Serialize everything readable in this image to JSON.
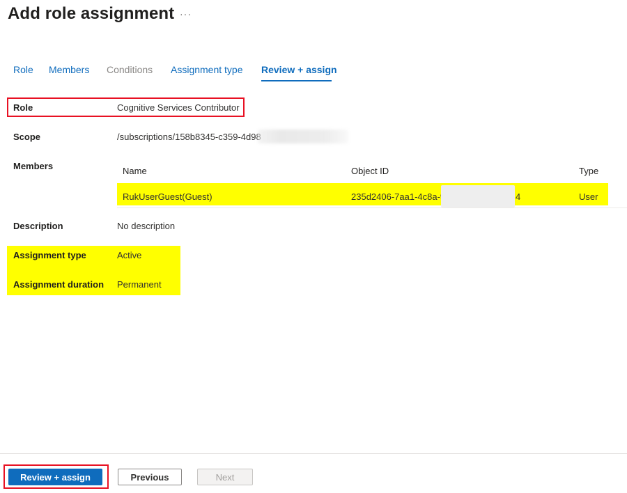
{
  "header": {
    "title": "Add role assignment",
    "more_icon": "more-horizontal-icon",
    "more_glyph": "···"
  },
  "tabs": [
    {
      "label": "Role",
      "state": "enabled"
    },
    {
      "label": "Members",
      "state": "enabled"
    },
    {
      "label": "Conditions",
      "state": "disabled"
    },
    {
      "label": "Assignment type",
      "state": "enabled"
    },
    {
      "label": "Review + assign",
      "state": "active"
    }
  ],
  "review": {
    "role": {
      "label": "Role",
      "value": "Cognitive Services Contributor"
    },
    "scope": {
      "label": "Scope",
      "value": "/subscriptions/158b8345-c359-4d98"
    },
    "members": {
      "label": "Members",
      "columns": [
        "Name",
        "Object ID",
        "Type"
      ],
      "rows": [
        {
          "name": "RukUserGuest(Guest)",
          "object_id_prefix": "235d2406-7aa1-4c8a-9",
          "object_id_suffix": "4",
          "type": "User"
        }
      ]
    },
    "description": {
      "label": "Description",
      "value": "No description"
    },
    "assignment_type": {
      "label": "Assignment type",
      "value": "Active"
    },
    "assignment_duration": {
      "label": "Assignment duration",
      "value": "Permanent"
    }
  },
  "footer": {
    "review_assign": "Review + assign",
    "previous": "Previous",
    "next": "Next"
  },
  "colors": {
    "accent": "#0f6cbd",
    "highlight": "#ffff00",
    "annotation_red": "#e81123"
  }
}
